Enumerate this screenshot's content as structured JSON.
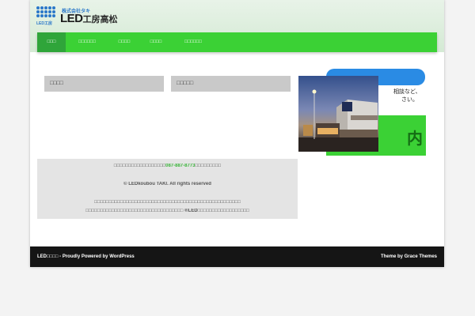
{
  "header": {
    "logo_sub": "LED工房",
    "logo_small": "株式会社タキ",
    "logo_main": "LED",
    "logo_tail": "工房高松"
  },
  "nav": {
    "items": [
      {
        "label": "□□□"
      },
      {
        "label": "□□□□□□"
      },
      {
        "label": "□□□□"
      },
      {
        "label": "□□□□"
      },
      {
        "label": "□□□□□□"
      }
    ]
  },
  "widgets": {
    "left_title": "□□□□",
    "right_title": "□□□□□"
  },
  "banner": {
    "text1": "相談など、",
    "text2": "さい。",
    "green_char": "内"
  },
  "footer_info": {
    "line1_prefix": "□□□□□□□□□□□□□□□□□□",
    "phone": "087-887-8773",
    "line1_suffix": "□□□□□□□□□",
    "copyright": "© LEDkoubou TAKI. All rights reserved",
    "line3": "□□□□□□□□□□□□□□□□□□□□□□□□□□□□□□□□□□□□□□□□□□□□□□□□□□□",
    "line4": "□□□□□□□□□□□□□□□□□□□□□□□□□□□□□□□□□□ ®LED□□□□□□□□□□□□□□□□□□"
  },
  "bottom": {
    "site_name": "LED□□□□",
    "powered_sep": " - ",
    "powered": "Proudly Powered by WordPress",
    "theme": "Theme by Grace Themes"
  },
  "colors": {
    "nav_green": "#3bd135",
    "nav_active": "#2fa53a",
    "footer_bar": "#151515",
    "accent_blue": "#2a8be4"
  }
}
